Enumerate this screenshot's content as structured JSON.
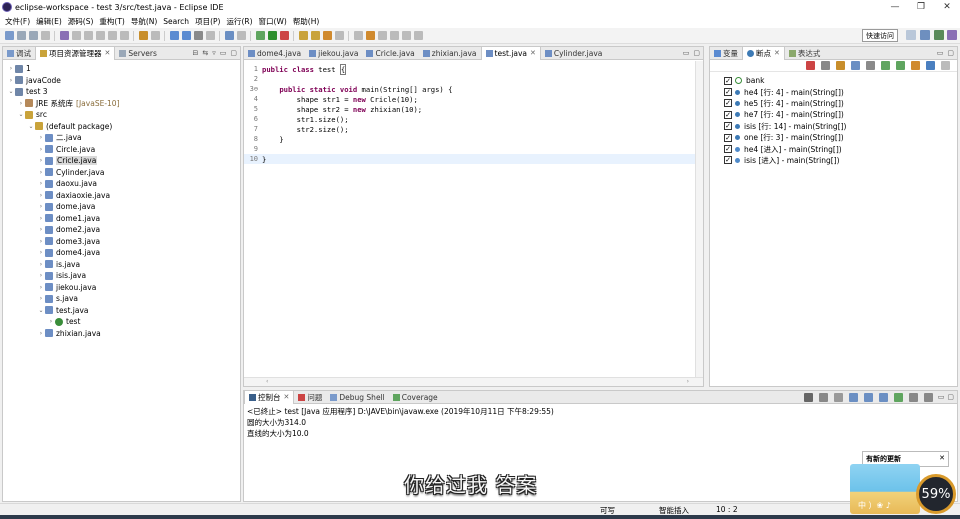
{
  "window": {
    "title": "eclipse-workspace - test 3/src/test.java - Eclipse IDE",
    "minimize_glyph": "—",
    "restore_glyph": "❐",
    "close_glyph": "✕"
  },
  "menu": [
    "文件(F)",
    "编辑(E)",
    "源码(S)",
    "重构(T)",
    "导航(N)",
    "Search",
    "项目(P)",
    "运行(R)",
    "窗口(W)",
    "帮助(H)"
  ],
  "toolbar": {
    "quick_access": "快速访问"
  },
  "left_panel": {
    "tabs": [
      "调试",
      "项目资源管理器",
      "Servers"
    ],
    "tree": [
      {
        "indent": 0,
        "arrow": "›",
        "label": "1",
        "icon": "project-icon"
      },
      {
        "indent": 0,
        "arrow": "›",
        "label": "javaCode",
        "icon": "project-icon"
      },
      {
        "indent": 0,
        "arrow": "⌄",
        "label": "test 3",
        "icon": "project-icon"
      },
      {
        "indent": 1,
        "arrow": "›",
        "label": "JRE 系统库",
        "sub": "[JavaSE-10]",
        "icon": "library-icon"
      },
      {
        "indent": 1,
        "arrow": "⌄",
        "label": "src",
        "icon": "source-folder-icon"
      },
      {
        "indent": 2,
        "arrow": "⌄",
        "label": "(default package)",
        "icon": "package-icon"
      },
      {
        "indent": 3,
        "arrow": "›",
        "label": "二.java",
        "icon": "java-file-icon"
      },
      {
        "indent": 3,
        "arrow": "›",
        "label": "Circle.java",
        "icon": "java-file-icon"
      },
      {
        "indent": 3,
        "arrow": "›",
        "label": "Cricle.java",
        "icon": "java-file-icon",
        "selected": true
      },
      {
        "indent": 3,
        "arrow": "›",
        "label": "Cylinder.java",
        "icon": "java-file-icon"
      },
      {
        "indent": 3,
        "arrow": "›",
        "label": "daoxu.java",
        "icon": "java-file-icon"
      },
      {
        "indent": 3,
        "arrow": "›",
        "label": "daxiaoxie.java",
        "icon": "java-file-icon"
      },
      {
        "indent": 3,
        "arrow": "›",
        "label": "dome.java",
        "icon": "java-file-icon"
      },
      {
        "indent": 3,
        "arrow": "›",
        "label": "dome1.java",
        "icon": "java-file-icon"
      },
      {
        "indent": 3,
        "arrow": "›",
        "label": "dome2.java",
        "icon": "java-file-icon"
      },
      {
        "indent": 3,
        "arrow": "›",
        "label": "dome3.java",
        "icon": "java-file-icon"
      },
      {
        "indent": 3,
        "arrow": "›",
        "label": "dome4.java",
        "icon": "java-file-icon"
      },
      {
        "indent": 3,
        "arrow": "›",
        "label": "is.java",
        "icon": "java-file-icon"
      },
      {
        "indent": 3,
        "arrow": "›",
        "label": "isis.java",
        "icon": "java-file-icon"
      },
      {
        "indent": 3,
        "arrow": "›",
        "label": "jiekou.java",
        "icon": "java-file-icon"
      },
      {
        "indent": 3,
        "arrow": "›",
        "label": "s.java",
        "icon": "java-file-icon"
      },
      {
        "indent": 3,
        "arrow": "⌄",
        "label": "test.java",
        "icon": "java-file-icon"
      },
      {
        "indent": 4,
        "arrow": "›",
        "label": "test",
        "icon": "class-icon"
      },
      {
        "indent": 3,
        "arrow": "›",
        "label": "zhixian.java",
        "icon": "java-file-icon"
      }
    ]
  },
  "editor": {
    "tabs": [
      {
        "label": "dome4.java",
        "active": false
      },
      {
        "label": "jiekou.java",
        "active": false
      },
      {
        "label": "Cricle.java",
        "active": false
      },
      {
        "label": "zhixian.java",
        "active": false
      },
      {
        "label": "test.java",
        "active": true
      },
      {
        "label": "Cylinder.java",
        "active": false
      }
    ],
    "lines": [
      {
        "n": "1",
        "html": "<span class=\"kw\">public</span> <span class=\"kw\">class</span> test <span class=\"cursor-box\">{</span>"
      },
      {
        "n": "2",
        "html": ""
      },
      {
        "n": "3⊖",
        "html": "    <span class=\"kw\">public</span> <span class=\"kw\">static</span> <span class=\"kw\">void</span> main(String[] args) {"
      },
      {
        "n": "4",
        "html": "        shape str1 = <span class=\"kw\">new</span> Cricle(10);"
      },
      {
        "n": "5",
        "html": "        shape str2 = <span class=\"kw\">new</span> zhixian(10);"
      },
      {
        "n": "6",
        "html": "        str1.size();"
      },
      {
        "n": "7",
        "html": "        str2.size();"
      },
      {
        "n": "8",
        "html": "    }"
      },
      {
        "n": "9",
        "html": ""
      },
      {
        "n": "10",
        "html": "}",
        "current": true
      }
    ]
  },
  "right_panel": {
    "tabs": [
      "变量",
      "断点",
      "表达式"
    ],
    "breakpoints": [
      {
        "type": "watch",
        "label": "bank"
      },
      {
        "type": "line",
        "label": "he4 [行:  4] - main(String[])"
      },
      {
        "type": "line",
        "label": "he5 [行:  4] - main(String[])"
      },
      {
        "type": "line",
        "label": "he7 [行:  4] - main(String[])"
      },
      {
        "type": "line",
        "label": "isis [行:  14] - main(String[])"
      },
      {
        "type": "line",
        "label": "one [行:  3] - main(String[])"
      },
      {
        "type": "entry",
        "label": "he4 [进入] - main(String[])"
      },
      {
        "type": "entry",
        "label": "isis [进入] - main(String[])"
      }
    ]
  },
  "console": {
    "tabs": [
      "控制台",
      "问题",
      "Debug Shell",
      "Coverage"
    ],
    "lines": [
      "<已终止> test [Java 应用程序] D:\\JAVE\\bin\\javaw.exe  (2019年10月11日 下午8:29:55)",
      "圆的大小为314.0",
      "直线的大小为10.0"
    ]
  },
  "status": {
    "writable": "可写",
    "insert_mode": "智能插入",
    "position": "10 : 2"
  },
  "overlay": {
    "subtitle": "你给过我 答案",
    "update_title": "有新的更新",
    "percent": "59%",
    "badge_text": "中 ）❀ ♪"
  },
  "colors": {
    "keyword": "#7f0055",
    "java_file": "#6d8ec4",
    "package": "#c9a33b",
    "breakpoint": "#3d7ab5"
  }
}
